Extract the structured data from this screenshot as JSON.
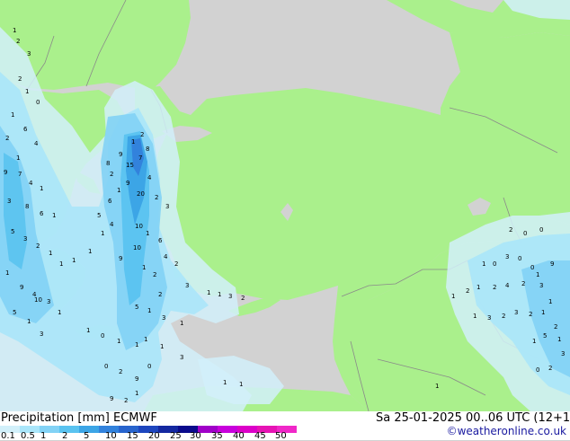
{
  "header": {
    "title": "Precipitation [mm]",
    "model": "ECMWF",
    "valid": "Sa 25-01-2025 00..06 UTC (12+162)",
    "credit": "©weatheronline.co.uk"
  },
  "colors": {
    "sea": "#d2d2d2",
    "land": "#aaf08c",
    "border": "#8a8a8a",
    "coast": "#8a8a8a"
  },
  "legend": {
    "ticks": [
      "0.1",
      "0.5",
      "1",
      "2",
      "5",
      "10",
      "15",
      "20",
      "25",
      "30",
      "35",
      "40",
      "45",
      "50"
    ],
    "colors": [
      "#d2f0fa",
      "#aae6fa",
      "#82d2f5",
      "#5ac3f0",
      "#3ca5e6",
      "#3282dc",
      "#2864cd",
      "#1e46be",
      "#1428a0",
      "#0a0a8c",
      "#a000c8",
      "#c800dc",
      "#dc00c8",
      "#e614b4",
      "#f028c8"
    ]
  },
  "map": {
    "values": [
      {
        "t": "1"
      },
      {
        "t": "2"
      },
      {
        "t": "3"
      },
      {
        "t": "2"
      },
      {
        "t": "1"
      },
      {
        "t": "0"
      },
      {
        "t": "1"
      },
      {
        "t": "6"
      },
      {
        "t": "4"
      },
      {
        "t": "2"
      },
      {
        "t": "1"
      },
      {
        "t": "9"
      },
      {
        "t": "7"
      },
      {
        "t": "4"
      },
      {
        "t": "1"
      },
      {
        "t": "3"
      },
      {
        "t": "8"
      },
      {
        "t": "6"
      },
      {
        "t": "1"
      },
      {
        "t": "5"
      },
      {
        "t": "3"
      },
      {
        "t": "2"
      },
      {
        "t": "1"
      },
      {
        "t": "1"
      },
      {
        "t": "1"
      },
      {
        "t": "9"
      },
      {
        "t": "4"
      },
      {
        "t": "3"
      },
      {
        "t": "1"
      },
      {
        "t": "10"
      },
      {
        "t": "5"
      },
      {
        "t": "1"
      },
      {
        "t": "3"
      },
      {
        "t": "1"
      },
      {
        "t": "1"
      },
      {
        "t": "1"
      },
      {
        "t": "4"
      },
      {
        "t": "5"
      },
      {
        "t": "6"
      },
      {
        "t": "1"
      },
      {
        "t": "2"
      },
      {
        "t": "8"
      },
      {
        "t": "9"
      },
      {
        "t": "15"
      },
      {
        "t": "7"
      },
      {
        "t": "8"
      },
      {
        "t": "1"
      },
      {
        "t": "2"
      },
      {
        "t": "9"
      },
      {
        "t": "20"
      },
      {
        "t": "4"
      },
      {
        "t": "2"
      },
      {
        "t": "3"
      },
      {
        "t": "10"
      },
      {
        "t": "1"
      },
      {
        "t": "6"
      },
      {
        "t": "9"
      },
      {
        "t": "10"
      },
      {
        "t": "1"
      },
      {
        "t": "2"
      },
      {
        "t": "4"
      },
      {
        "t": "2"
      },
      {
        "t": "3"
      },
      {
        "t": "2"
      },
      {
        "t": "5"
      },
      {
        "t": "1"
      },
      {
        "t": "3"
      },
      {
        "t": "1"
      },
      {
        "t": "1"
      },
      {
        "t": "1"
      },
      {
        "t": "3"
      },
      {
        "t": "2"
      },
      {
        "t": "1"
      },
      {
        "t": "0"
      },
      {
        "t": "1"
      },
      {
        "t": "1"
      },
      {
        "t": "1"
      },
      {
        "t": "1"
      },
      {
        "t": "3"
      },
      {
        "t": "0"
      },
      {
        "t": "2"
      },
      {
        "t": "9"
      },
      {
        "t": "0"
      },
      {
        "t": "9"
      },
      {
        "t": "2"
      },
      {
        "t": "1"
      },
      {
        "t": "1"
      },
      {
        "t": "1"
      },
      {
        "t": "1"
      },
      {
        "t": "1"
      },
      {
        "t": "0"
      },
      {
        "t": "3"
      },
      {
        "t": "0"
      },
      {
        "t": "0"
      },
      {
        "t": "3"
      },
      {
        "t": "1"
      },
      {
        "t": "1"
      },
      {
        "t": "2"
      },
      {
        "t": "1"
      },
      {
        "t": "2"
      },
      {
        "t": "4"
      },
      {
        "t": "2"
      },
      {
        "t": "1"
      },
      {
        "t": "9"
      },
      {
        "t": "1"
      },
      {
        "t": "3"
      },
      {
        "t": "2"
      },
      {
        "t": "3"
      },
      {
        "t": "2"
      },
      {
        "t": "1"
      },
      {
        "t": "2"
      },
      {
        "t": "1"
      },
      {
        "t": "5"
      },
      {
        "t": "1"
      },
      {
        "t": "0"
      },
      {
        "t": "2"
      },
      {
        "t": "3"
      },
      {
        "t": "2"
      },
      {
        "t": "0"
      },
      {
        "t": "0"
      }
    ]
  }
}
